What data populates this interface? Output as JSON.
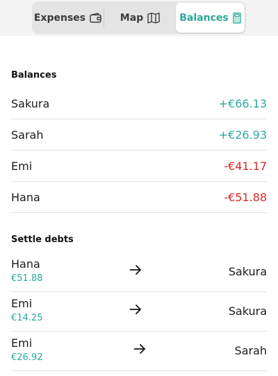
{
  "tabs": {
    "expenses": "Expenses",
    "map": "Map",
    "balances": "Balances"
  },
  "colors": {
    "accent": "#2aa89a",
    "negative": "#e02424"
  },
  "balances": {
    "title": "Balances",
    "rows": [
      {
        "name": "Sakura",
        "amount": "+€66.13"
      },
      {
        "name": "Sarah",
        "amount": "+€26.93"
      },
      {
        "name": "Emi",
        "amount": "-€41.17"
      },
      {
        "name": "Hana",
        "amount": "-€51.88"
      }
    ]
  },
  "settle": {
    "title": "Settle debts",
    "rows": [
      {
        "from": "Hana",
        "amount": "€51.88",
        "to": "Sakura"
      },
      {
        "from": "Emi",
        "amount": "€14.25",
        "to": "Sakura"
      },
      {
        "from": "Emi",
        "amount": "€26.92",
        "to": "Sarah"
      }
    ]
  }
}
